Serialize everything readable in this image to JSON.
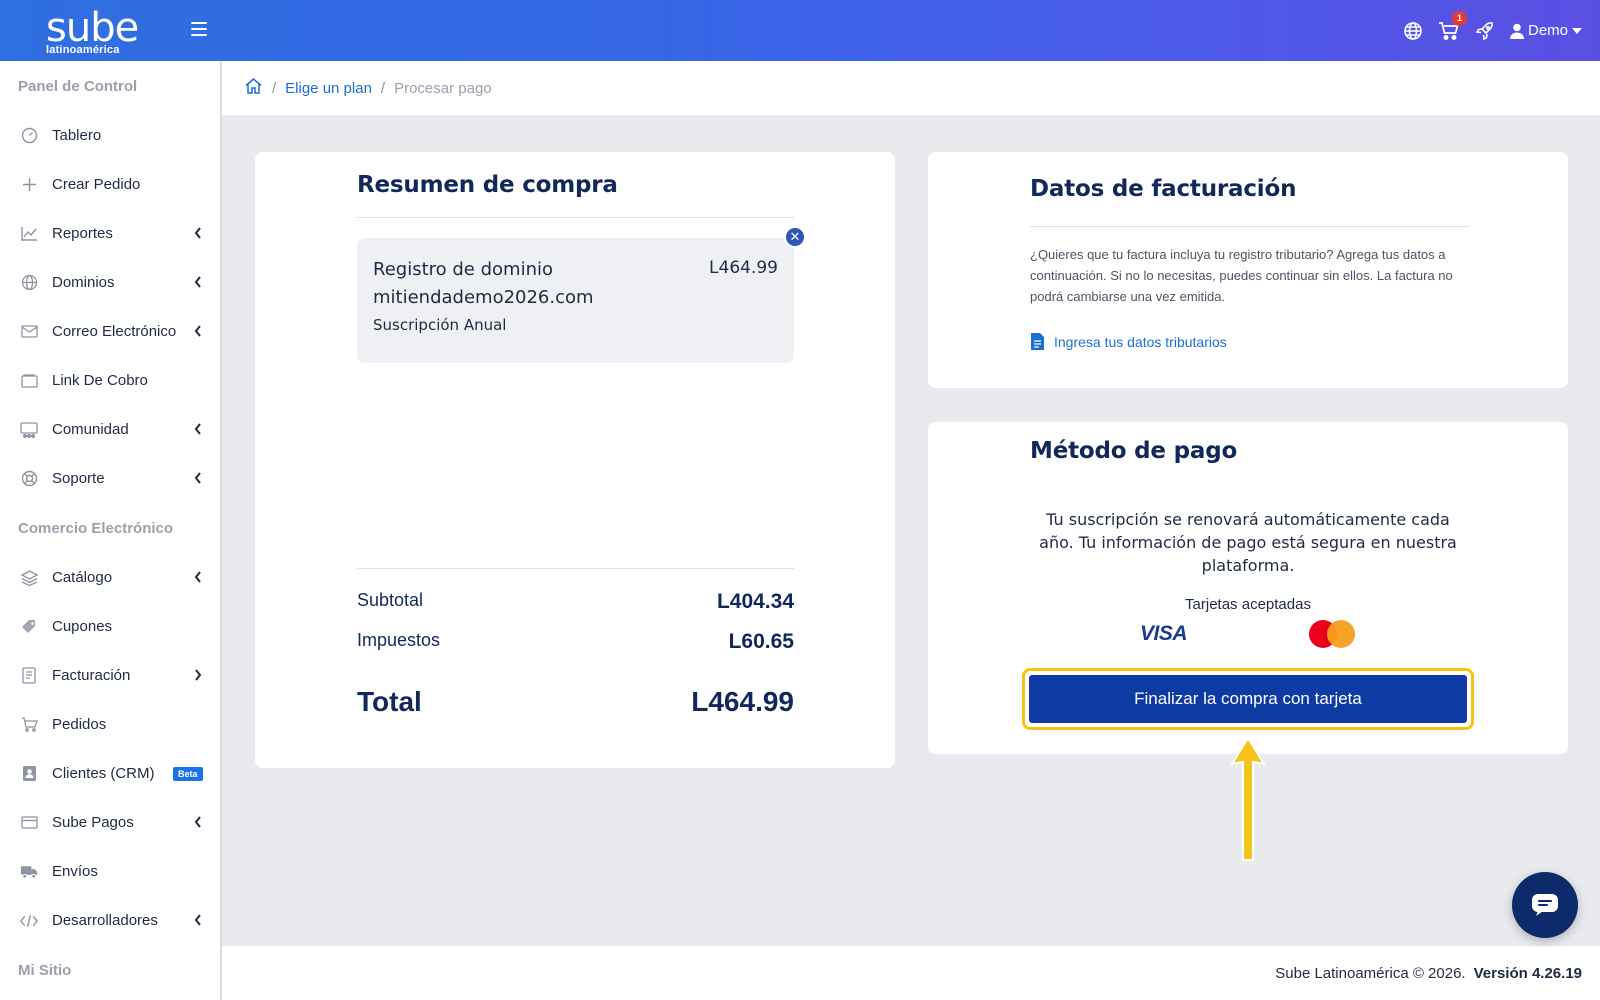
{
  "brand": {
    "name": "sube",
    "tagline": "latinoamérica"
  },
  "header": {
    "cart_count": "1",
    "user_label": "Demo",
    "icons": [
      "globe-icon",
      "cart-icon",
      "rocket-icon",
      "user-icon"
    ]
  },
  "sidebar": {
    "sections": [
      "Panel de Control",
      "Comercio Electrónico",
      "Mi Sitio"
    ],
    "items": [
      {
        "label": "Tablero",
        "icon": "gauge-icon"
      },
      {
        "label": "Crear Pedido",
        "icon": "plus-icon"
      },
      {
        "label": "Reportes",
        "icon": "chart-icon"
      },
      {
        "label": "Dominios",
        "icon": "globe-icon"
      },
      {
        "label": "Correo Electrónico",
        "icon": "mail-icon"
      },
      {
        "label": "Link De Cobro",
        "icon": "wallet-icon"
      },
      {
        "label": "Comunidad",
        "icon": "community-icon"
      },
      {
        "label": "Soporte",
        "icon": "lifebuoy-icon"
      },
      {
        "label": "Catálogo",
        "icon": "layers-icon"
      },
      {
        "label": "Cupones",
        "icon": "tag-icon"
      },
      {
        "label": "Facturación",
        "icon": "invoice-icon"
      },
      {
        "label": "Pedidos",
        "icon": "basket-icon"
      },
      {
        "label": "Clientes (CRM)",
        "icon": "contact-icon",
        "badge": "Beta"
      },
      {
        "label": "Sube Pagos",
        "icon": "card-icon"
      },
      {
        "label": "Envíos",
        "icon": "truck-icon"
      },
      {
        "label": "Desarrolladores",
        "icon": "code-icon"
      }
    ]
  },
  "breadcrumb": {
    "items": [
      "Elige un plan",
      "Procesar pago"
    ]
  },
  "summary": {
    "title": "Resumen de compra",
    "item": {
      "name_line1": "Registro de dominio",
      "name_line2": "mitiendademo2026.com",
      "subscription": "Suscripción Anual",
      "price": "L464.99"
    },
    "subtotal_label": "Subtotal",
    "subtotal_value": "L404.34",
    "tax_label": "Impuestos",
    "tax_value": "L60.65",
    "total_label": "Total",
    "total_value": "L464.99"
  },
  "billing": {
    "title": "Datos de facturación",
    "text": "¿Quieres que tu factura incluya tu registro tributario? Agrega tus datos a continuación. Si no lo necesitas, puedes continuar sin ellos. La factura no podrá cambiarse una vez emitida.",
    "link": "Ingresa tus datos tributarios"
  },
  "payment": {
    "title": "Método de pago",
    "text": "Tu suscripción se renovará automáticamente cada año. Tu información de pago está segura en nuestra plataforma.",
    "cards_label": "Tarjetas aceptadas",
    "visa_label": "VISA",
    "button": "Finalizar la compra con tarjeta"
  },
  "footer": {
    "copyright": "Sube Latinoamérica © 2026.",
    "version": "Versión 4.26.19"
  },
  "colors": {
    "primary": "#0d3aa3",
    "accent": "#f4c518",
    "link": "#1a6fd6",
    "heading": "#12285a"
  }
}
